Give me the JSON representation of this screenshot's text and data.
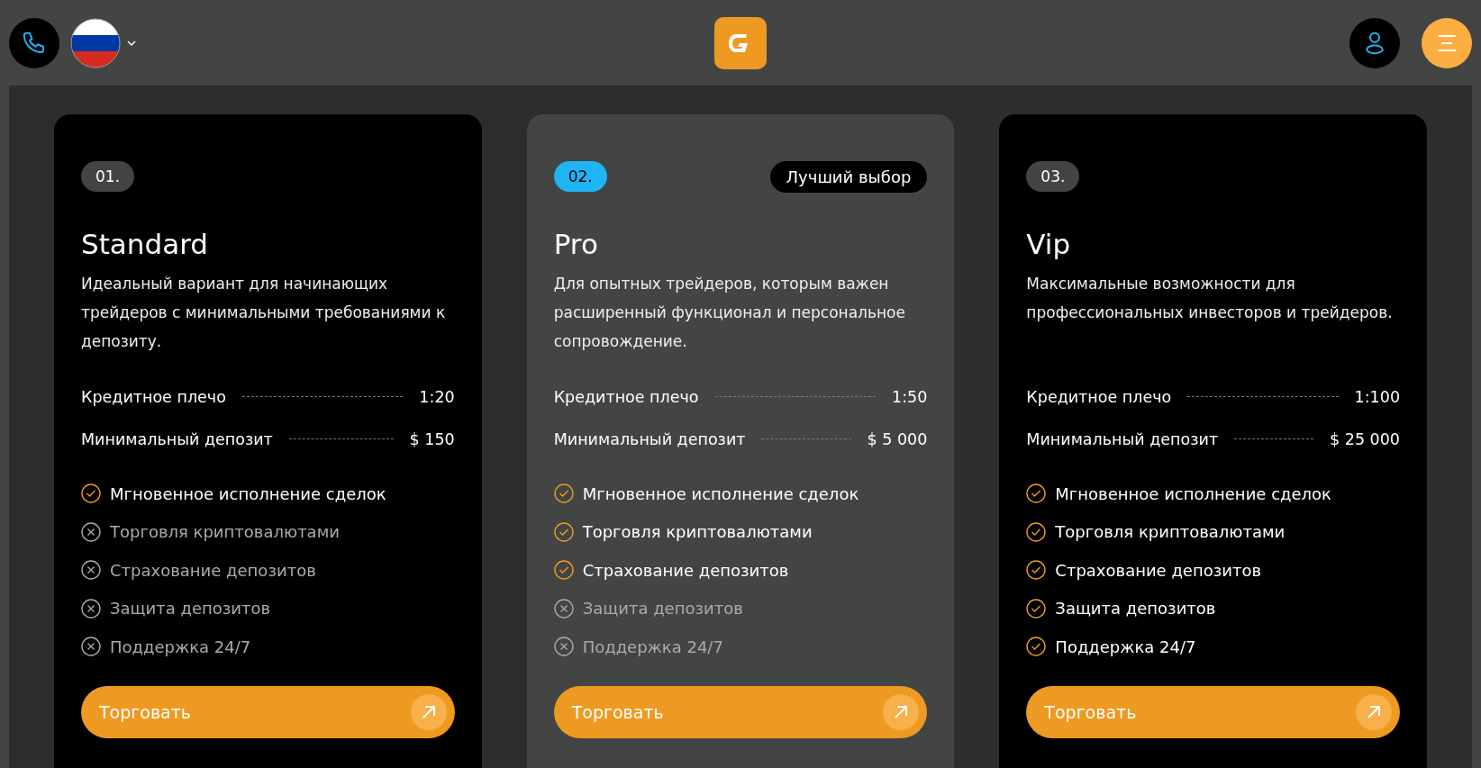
{
  "header": {
    "menu_open": false
  },
  "plans": [
    {
      "number": "01.",
      "selected": false,
      "name": "Standard",
      "description": "Идеальный вариант для начинающих трейдеров с минимальными требованиями к депозиту.",
      "specs": [
        {
          "label": "Кредитное плечо",
          "value": "1:20"
        },
        {
          "label": "Минимальный депозит",
          "value": "$ 150"
        }
      ],
      "features": [
        {
          "label": "Мгновенное исполнение сделок",
          "included": true
        },
        {
          "label": "Торговля криптовалютами",
          "included": false
        },
        {
          "label": "Страхование депозитов",
          "included": false
        },
        {
          "label": "Защита депозитов",
          "included": false
        },
        {
          "label": "Поддержка 24/7",
          "included": false
        }
      ],
      "button": "Торговать"
    },
    {
      "number": "02.",
      "selected": true,
      "badge": "Лучший выбор",
      "name": "Pro",
      "description": "Для опытных трейдеров, которым важен расширенный функционал и персональное сопровождение.",
      "specs": [
        {
          "label": "Кредитное плечо",
          "value": "1:50"
        },
        {
          "label": "Минимальный депозит",
          "value": "$ 5 000"
        }
      ],
      "features": [
        {
          "label": "Мгновенное исполнение сделок",
          "included": true
        },
        {
          "label": "Торговля криптовалютами",
          "included": true
        },
        {
          "label": "Страхование депозитов",
          "included": true
        },
        {
          "label": "Защита депозитов",
          "included": false
        },
        {
          "label": "Поддержка 24/7",
          "included": false
        }
      ],
      "button": "Торговать"
    },
    {
      "number": "03.",
      "selected": false,
      "name": "Vip",
      "description": "Максимальные возможности для профессиональных инвесторов и трейдеров.",
      "specs": [
        {
          "label": "Кредитное плечо",
          "value": "1:100"
        },
        {
          "label": "Минимальный депозит",
          "value": "$ 25 000"
        }
      ],
      "features": [
        {
          "label": "Мгновенное исполнение сделок",
          "included": true
        },
        {
          "label": "Торговля криптовалютами",
          "included": true
        },
        {
          "label": "Страхование депозитов",
          "included": true
        },
        {
          "label": "Защита депозитов",
          "included": true
        },
        {
          "label": "Поддержка 24/7",
          "included": true
        }
      ],
      "button": "Торговать"
    }
  ]
}
